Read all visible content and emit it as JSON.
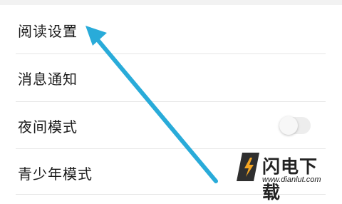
{
  "settings": {
    "items": [
      {
        "label": "阅读设置"
      },
      {
        "label": "消息通知"
      },
      {
        "label": "夜间模式",
        "toggle": "off"
      },
      {
        "label": "青少年模式"
      }
    ]
  },
  "watermark": {
    "brand": "闪电下载",
    "url": "www.dianlut.com"
  },
  "colors": {
    "arrow": "#29abd9",
    "logo": "#2f2f2f",
    "logo_bolt": "#f5a623"
  }
}
